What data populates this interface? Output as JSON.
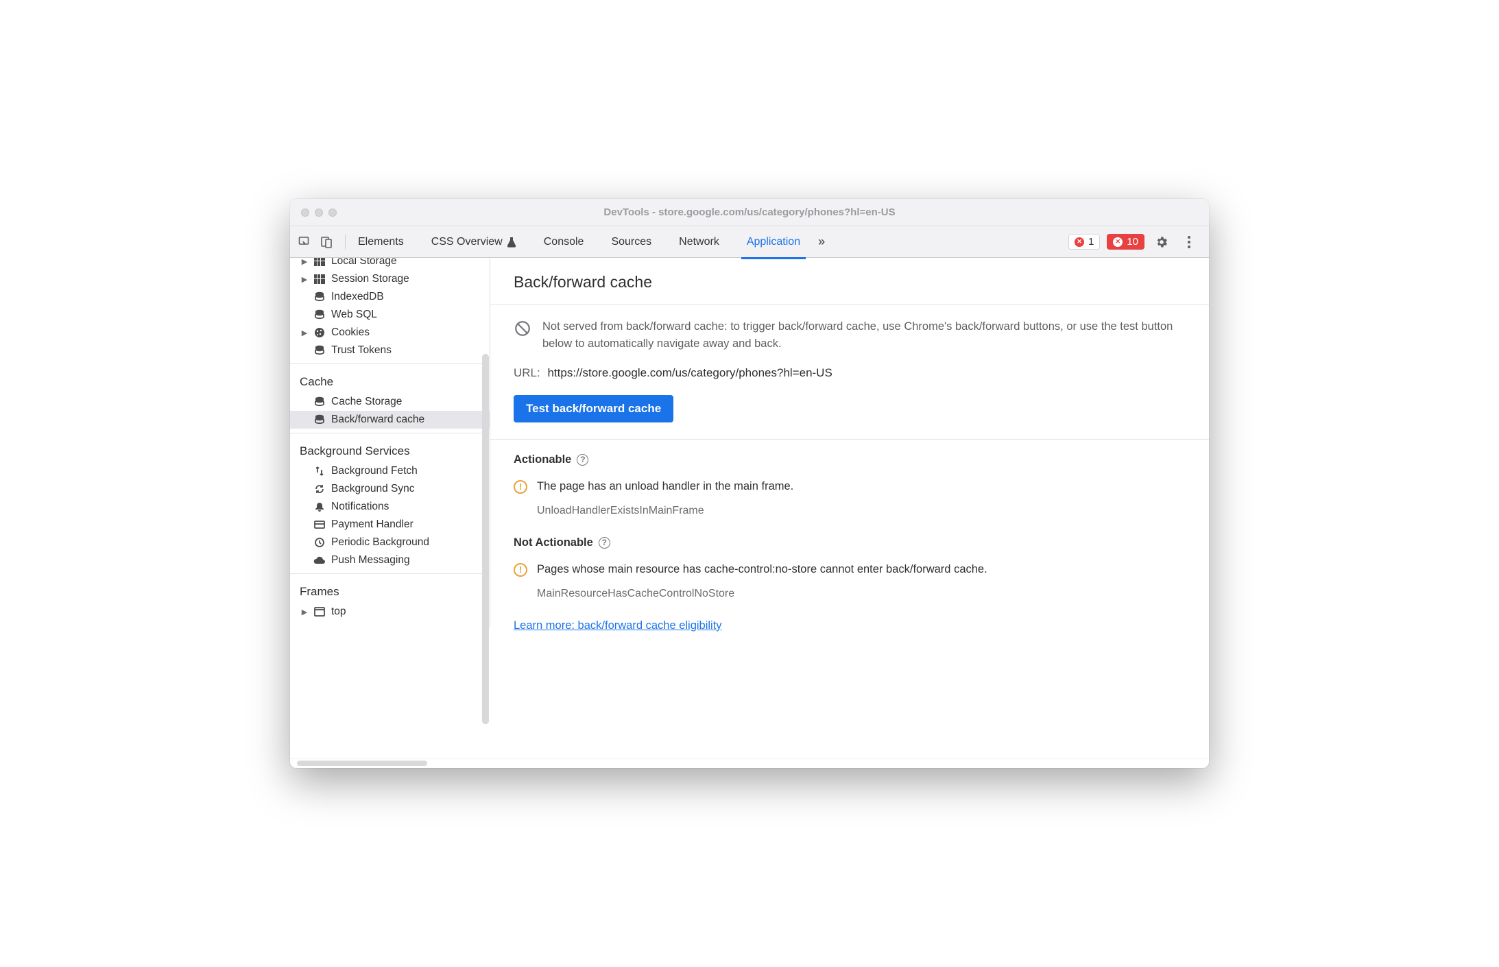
{
  "window": {
    "title": "DevTools - store.google.com/us/category/phones?hl=en-US"
  },
  "tabs": {
    "elements": "Elements",
    "css_overview": "CSS Overview",
    "console": "Console",
    "sources": "Sources",
    "network": "Network",
    "application": "Application"
  },
  "counters": {
    "errors": "1",
    "issues": "10"
  },
  "sidebar": {
    "storage": {
      "local_storage": "Local Storage",
      "session_storage": "Session Storage",
      "indexeddb": "IndexedDB",
      "websql": "Web SQL",
      "cookies": "Cookies",
      "trust_tokens": "Trust Tokens"
    },
    "cache": {
      "heading": "Cache",
      "cache_storage": "Cache Storage",
      "bf_cache": "Back/forward cache"
    },
    "bg": {
      "heading": "Background Services",
      "fetch": "Background Fetch",
      "sync": "Background Sync",
      "notifications": "Notifications",
      "payment": "Payment Handler",
      "periodic": "Periodic Background",
      "push": "Push Messaging"
    },
    "frames": {
      "heading": "Frames",
      "top": "top"
    }
  },
  "panel": {
    "title": "Back/forward cache",
    "note": "Not served from back/forward cache: to trigger back/forward cache, use Chrome's back/forward buttons, or use the test button below to automatically navigate away and back.",
    "url_label": "URL:",
    "url": "https://store.google.com/us/category/phones?hl=en-US",
    "test_button": "Test back/forward cache",
    "actionable": {
      "heading": "Actionable",
      "issue_text": "The page has an unload handler in the main frame.",
      "issue_code": "UnloadHandlerExistsInMainFrame"
    },
    "not_actionable": {
      "heading": "Not Actionable",
      "issue_text": "Pages whose main resource has cache-control:no-store cannot enter back/forward cache.",
      "issue_code": "MainResourceHasCacheControlNoStore"
    },
    "learn_more": "Learn more: back/forward cache eligibility"
  }
}
